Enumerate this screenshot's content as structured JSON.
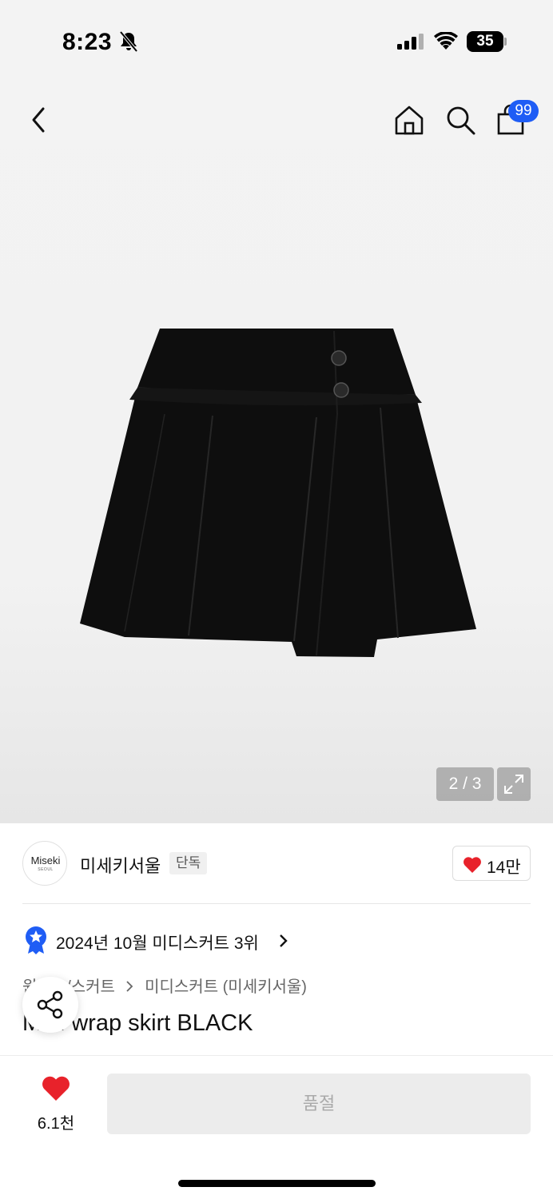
{
  "status": {
    "time": "8:23",
    "battery": "35"
  },
  "nav": {
    "cart_count": "99"
  },
  "gallery": {
    "pager": "2 / 3"
  },
  "brand": {
    "logo_text": "Miseki",
    "logo_sub": "SEOUL",
    "name": "미세키서울",
    "exclusive_tag": "단독",
    "likes": "14만"
  },
  "ranking": {
    "text": "2024년 10월 미디스커트 3위"
  },
  "breadcrumb": [
    "원피스/스커트",
    "미디스커트 (미세키서울)"
  ],
  "product": {
    "title": "Midi wrap skirt BLACK"
  },
  "bottom": {
    "wish_count": "6.1천",
    "cta_label": "품절"
  },
  "colors": {
    "accent_blue": "#1f5df5",
    "heart_red": "#e8222b"
  }
}
